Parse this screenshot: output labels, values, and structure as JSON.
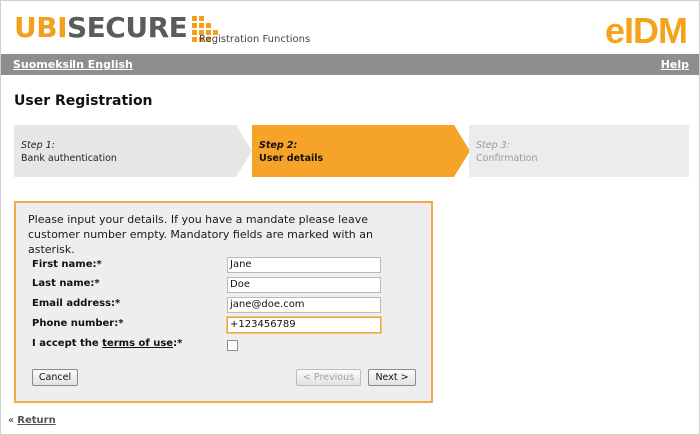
{
  "header": {
    "logo_part1": "UBI",
    "logo_part2": "SECURE",
    "section_title": "Registration Functions",
    "product_mark": "eIDM"
  },
  "nav": {
    "lang_fi": "Suomeksi",
    "lang_en": "In English",
    "help": "Help"
  },
  "page_title": "User Registration",
  "steps": [
    {
      "number": "Step 1:",
      "label": "Bank authentication",
      "state": "done"
    },
    {
      "number": "Step 2:",
      "label": "User details",
      "state": "active"
    },
    {
      "number": "Step 3:",
      "label": "Confirmation",
      "state": "todo"
    }
  ],
  "form": {
    "intro": "Please input your details. If you have a mandate please leave customer number empty. Mandatory fields are marked with an asterisk.",
    "first_name_label": "First name:*",
    "first_name_value": "Jane",
    "last_name_label": "Last name:*",
    "last_name_value": "Doe",
    "email_label": "Email address:*",
    "email_value": "jane@doe.com",
    "phone_label": "Phone number:*",
    "phone_value": "+123456789",
    "terms_prefix": "I accept the ",
    "terms_link": "terms of use",
    "terms_suffix": ":*",
    "terms_checked": false,
    "cancel": "Cancel",
    "previous": "< Previous",
    "next": "Next >"
  },
  "footer": {
    "return_prefix": "« ",
    "return_link": "Return"
  },
  "colors": {
    "brand_orange": "#f6a32a",
    "brand_gray": "#5b5b5b",
    "nav_bar": "#8e8e8e"
  }
}
